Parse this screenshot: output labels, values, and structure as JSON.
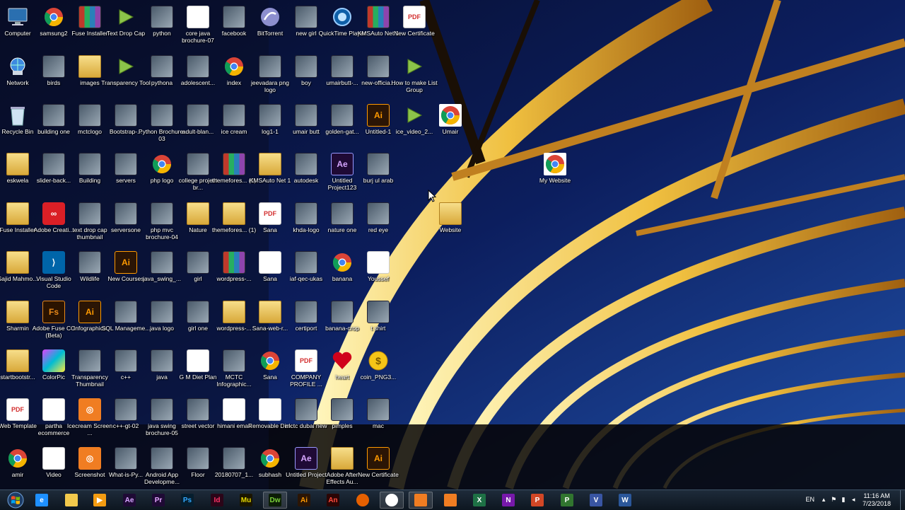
{
  "desktop": {
    "icons": [
      {
        "label": "Computer",
        "type": "computer",
        "icon": "computer-icon"
      },
      {
        "label": "samsung2",
        "type": "chrome",
        "icon": "chrome-icon"
      },
      {
        "label": "Fuse Installer",
        "type": "winrar",
        "icon": "winrar-icon"
      },
      {
        "label": "Text Drop Cap",
        "type": "video",
        "icon": "video-file-icon"
      },
      {
        "label": "python",
        "type": "image",
        "icon": "image-thumbnail-icon"
      },
      {
        "label": "core java brochure-07",
        "type": "doc",
        "icon": "document-icon"
      },
      {
        "label": "facebook",
        "type": "image",
        "icon": "image-thumbnail-icon"
      },
      {
        "label": "BitTorrent",
        "type": "bittorrent",
        "icon": "bittorrent-icon"
      },
      {
        "label": "new girl",
        "type": "image",
        "icon": "image-thumbnail-icon"
      },
      {
        "label": "QuickTime Player",
        "type": "quicktime",
        "icon": "quicktime-icon"
      },
      {
        "label": "KMSAuto Net 1",
        "type": "winrar",
        "icon": "winrar-icon"
      },
      {
        "label": "New Certificate",
        "type": "pdf",
        "icon": "pdf-icon"
      },
      {
        "label": "Network",
        "type": "network",
        "icon": "network-icon"
      },
      {
        "label": "birds",
        "type": "image",
        "icon": "image-thumbnail-icon"
      },
      {
        "label": "images",
        "type": "folder",
        "icon": "folder-icon"
      },
      {
        "label": "Transparency Tool",
        "type": "video",
        "icon": "video-file-icon"
      },
      {
        "label": "pythona",
        "type": "image",
        "icon": "image-thumbnail-icon"
      },
      {
        "label": "adolescent...",
        "type": "image",
        "icon": "image-thumbnail-icon"
      },
      {
        "label": "index",
        "type": "chrome",
        "icon": "chrome-icon"
      },
      {
        "label": "jeevadara png logo",
        "type": "image",
        "icon": "image-thumbnail-icon"
      },
      {
        "label": "boy",
        "type": "image",
        "icon": "image-thumbnail-icon"
      },
      {
        "label": "umairbutt-...",
        "type": "image",
        "icon": "image-thumbnail-icon"
      },
      {
        "label": "new-officia...",
        "type": "image",
        "icon": "image-thumbnail-icon"
      },
      {
        "label": "How to make List Group",
        "type": "video",
        "icon": "video-file-icon"
      },
      {
        "label": "Recycle Bin",
        "type": "recycle",
        "icon": "recycle-bin-icon"
      },
      {
        "label": "building one",
        "type": "image",
        "icon": "image-thumbnail-icon"
      },
      {
        "label": "mctclogo",
        "type": "image",
        "icon": "image-thumbnail-icon"
      },
      {
        "label": "Bootstrap-...",
        "type": "image",
        "icon": "image-thumbnail-icon"
      },
      {
        "label": "Python Brochure-03",
        "type": "image",
        "icon": "image-thumbnail-icon"
      },
      {
        "label": "adult-blan...",
        "type": "image",
        "icon": "image-thumbnail-icon"
      },
      {
        "label": "ice cream",
        "type": "image",
        "icon": "image-thumbnail-icon"
      },
      {
        "label": "log1-1",
        "type": "image",
        "icon": "image-thumbnail-icon"
      },
      {
        "label": "umair butt",
        "type": "image",
        "icon": "image-thumbnail-icon"
      },
      {
        "label": "golden-gat...",
        "type": "image",
        "icon": "image-thumbnail-icon"
      },
      {
        "label": "Untitled-1",
        "type": "ai",
        "icon": "illustrator-icon"
      },
      {
        "label": "ice_video_2...",
        "type": "video",
        "icon": "video-file-icon"
      },
      {
        "label": "Umair",
        "type": "chromefile",
        "icon": "chrome-file-icon"
      },
      {
        "label": "eskwela",
        "type": "folder",
        "icon": "folder-icon"
      },
      {
        "label": "slider-back...",
        "type": "image",
        "icon": "image-thumbnail-icon"
      },
      {
        "label": "Building",
        "type": "image",
        "icon": "image-thumbnail-icon"
      },
      {
        "label": "servers",
        "type": "image",
        "icon": "image-thumbnail-icon"
      },
      {
        "label": "php logo",
        "type": "chrome",
        "icon": "chrome-icon"
      },
      {
        "label": "college project br...",
        "type": "image",
        "icon": "image-thumbnail-icon"
      },
      {
        "label": "themefores... (1)",
        "type": "winrar",
        "icon": "winrar-icon"
      },
      {
        "label": "KMSAuto Net 1",
        "type": "folder",
        "icon": "folder-icon"
      },
      {
        "label": "autodesk",
        "type": "image",
        "icon": "image-thumbnail-icon"
      },
      {
        "label": "Untitled Project123",
        "type": "ae",
        "icon": "after-effects-icon"
      },
      {
        "label": "burj ul arab",
        "type": "image",
        "icon": "image-thumbnail-icon"
      },
      {
        "label": "My Website",
        "type": "chromefile",
        "icon": "chrome-file-icon"
      },
      {
        "label": "Fuse Installer",
        "type": "pdffolder",
        "icon": "folder-icon"
      },
      {
        "label": "Adobe Creati...",
        "type": "acc",
        "icon": "creative-cloud-icon"
      },
      {
        "label": "text drop cap thumbnail",
        "type": "image",
        "icon": "image-thumbnail-icon"
      },
      {
        "label": "serversone",
        "type": "image",
        "icon": "image-thumbnail-icon"
      },
      {
        "label": "php mvc brochure-04",
        "type": "image",
        "icon": "image-thumbnail-icon"
      },
      {
        "label": "Nature",
        "type": "folder",
        "icon": "folder-icon"
      },
      {
        "label": "themefores... (1)",
        "type": "folder",
        "icon": "folder-icon"
      },
      {
        "label": "Sana",
        "type": "pdf",
        "icon": "pdf-icon"
      },
      {
        "label": "khda-logo",
        "type": "image",
        "icon": "image-thumbnail-icon"
      },
      {
        "label": "nature one",
        "type": "image",
        "icon": "image-thumbnail-icon"
      },
      {
        "label": "red eye",
        "type": "image",
        "icon": "image-thumbnail-icon"
      },
      {
        "label": "Website",
        "type": "folder",
        "icon": "folder-icon"
      },
      {
        "label": "Sajid Mahmo...",
        "type": "folder",
        "icon": "folder-icon"
      },
      {
        "label": "Visual Studio Code",
        "type": "vscode",
        "icon": "vscode-icon"
      },
      {
        "label": "Wildlife",
        "type": "image",
        "icon": "image-thumbnail-icon"
      },
      {
        "label": "New Courses",
        "type": "ai",
        "icon": "illustrator-icon"
      },
      {
        "label": "java_swing_...",
        "type": "image",
        "icon": "image-thumbnail-icon"
      },
      {
        "label": "girl",
        "type": "image",
        "icon": "image-thumbnail-icon"
      },
      {
        "label": "wordpress-...",
        "type": "winrar",
        "icon": "winrar-icon"
      },
      {
        "label": "Sana",
        "type": "doc",
        "icon": "document-icon"
      },
      {
        "label": "iaf-qec-ukas",
        "type": "image",
        "icon": "image-thumbnail-icon"
      },
      {
        "label": "banana",
        "type": "chrome",
        "icon": "chrome-icon"
      },
      {
        "label": "Youssef",
        "type": "doc",
        "icon": "document-icon"
      },
      {
        "label": "Sharmin",
        "type": "folder",
        "icon": "folder-icon"
      },
      {
        "label": "Adobe Fuse CC (Beta)",
        "type": "fs",
        "icon": "adobe-fuse-icon"
      },
      {
        "label": "Infographics",
        "type": "ai",
        "icon": "illustrator-icon"
      },
      {
        "label": "SQL Manageme...",
        "type": "image",
        "icon": "image-thumbnail-icon"
      },
      {
        "label": "java logo",
        "type": "image",
        "icon": "image-thumbnail-icon"
      },
      {
        "label": "girl one",
        "type": "image",
        "icon": "image-thumbnail-icon"
      },
      {
        "label": "wordpress-...",
        "type": "folder",
        "icon": "folder-icon"
      },
      {
        "label": "Sana-web-r...",
        "type": "folder",
        "icon": "folder-icon"
      },
      {
        "label": "certiport",
        "type": "image",
        "icon": "image-thumbnail-icon"
      },
      {
        "label": "banana-crop",
        "type": "image",
        "icon": "image-thumbnail-icon"
      },
      {
        "label": "t shirt",
        "type": "image",
        "icon": "image-thumbnail-icon"
      },
      {
        "label": "startbootstr...",
        "type": "folder",
        "icon": "folder-icon"
      },
      {
        "label": "ColorPic",
        "type": "colorpic",
        "icon": "colorpic-icon"
      },
      {
        "label": "Transparency Thumbnail",
        "type": "image",
        "icon": "image-thumbnail-icon"
      },
      {
        "label": "c++",
        "type": "image",
        "icon": "image-thumbnail-icon"
      },
      {
        "label": "java",
        "type": "image",
        "icon": "image-thumbnail-icon"
      },
      {
        "label": "G M Diet Plan",
        "type": "doc",
        "icon": "document-icon"
      },
      {
        "label": "MCTC Infographic...",
        "type": "image",
        "icon": "image-thumbnail-icon"
      },
      {
        "label": "Sana",
        "type": "chrome",
        "icon": "chrome-icon"
      },
      {
        "label": "COMPANY PROFILE ...",
        "type": "pdf",
        "icon": "pdf-icon"
      },
      {
        "label": "heart",
        "type": "heart",
        "icon": "heart-icon"
      },
      {
        "label": "coin_PNG3...",
        "type": "coin",
        "icon": "coin-icon"
      },
      {
        "label": "Web Template",
        "type": "pdf",
        "icon": "pdf-icon"
      },
      {
        "label": "partha ecommerce",
        "type": "doc",
        "icon": "document-icon"
      },
      {
        "label": "Icecream Screen ...",
        "type": "icecream",
        "icon": "icecream-recorder-icon"
      },
      {
        "label": "c++-gt-02",
        "type": "image",
        "icon": "image-thumbnail-icon"
      },
      {
        "label": "java swing brochure-05",
        "type": "image",
        "icon": "image-thumbnail-icon"
      },
      {
        "label": "street vector",
        "type": "image",
        "icon": "image-thumbnail-icon"
      },
      {
        "label": "himani email",
        "type": "doc",
        "icon": "document-icon"
      },
      {
        "label": "Removable Disk",
        "type": "doc",
        "icon": "removable-disk-icon"
      },
      {
        "label": "mctc dubai new",
        "type": "image",
        "icon": "image-thumbnail-icon"
      },
      {
        "label": "pimples",
        "type": "image",
        "icon": "image-thumbnail-icon"
      },
      {
        "label": "mac",
        "type": "image",
        "icon": "image-thumbnail-icon"
      },
      {
        "label": "amir",
        "type": "chrome",
        "icon": "chrome-icon"
      },
      {
        "label": "Video",
        "type": "doc",
        "icon": "document-icon"
      },
      {
        "label": "Screenshot",
        "type": "icecream",
        "icon": "icecream-screenshot-icon"
      },
      {
        "label": "What-is-Py...",
        "type": "image",
        "icon": "image-thumbnail-icon"
      },
      {
        "label": "Android App Developme...",
        "type": "image",
        "icon": "image-thumbnail-icon"
      },
      {
        "label": "Floor",
        "type": "image",
        "icon": "image-thumbnail-icon"
      },
      {
        "label": "20180707_1...",
        "type": "image",
        "icon": "image-thumbnail-icon"
      },
      {
        "label": "subhash",
        "type": "chrome",
        "icon": "chrome-icon"
      },
      {
        "label": "Untitled Project",
        "type": "ae",
        "icon": "after-effects-icon"
      },
      {
        "label": "Adobe After Effects Au...",
        "type": "aefolder",
        "icon": "folder-icon"
      },
      {
        "label": "New Certificate",
        "type": "ai",
        "icon": "illustrator-icon"
      }
    ]
  },
  "taskbar": {
    "start_icon": "windows-start-icon",
    "apps": [
      {
        "name": "ie",
        "icon": "internet-explorer-icon",
        "glyph": "e"
      },
      {
        "name": "explorer",
        "icon": "file-explorer-icon",
        "glyph": ""
      },
      {
        "name": "media",
        "icon": "media-player-icon",
        "glyph": "▶"
      },
      {
        "name": "ae",
        "icon": "after-effects-icon",
        "glyph": "Ae"
      },
      {
        "name": "pr",
        "icon": "premiere-icon",
        "glyph": "Pr"
      },
      {
        "name": "ps",
        "icon": "photoshop-icon",
        "glyph": "Ps"
      },
      {
        "name": "id",
        "icon": "indesign-icon",
        "glyph": "Id"
      },
      {
        "name": "mu",
        "icon": "muse-icon",
        "glyph": "Mu"
      },
      {
        "name": "dw",
        "icon": "dreamweaver-icon",
        "glyph": "Dw"
      },
      {
        "name": "ai",
        "icon": "illustrator-icon",
        "glyph": "Ai"
      },
      {
        "name": "an",
        "icon": "animate-icon",
        "glyph": "An"
      },
      {
        "name": "firefox",
        "icon": "firefox-icon",
        "glyph": ""
      },
      {
        "name": "chrome",
        "icon": "chrome-icon",
        "glyph": ""
      },
      {
        "name": "icecream",
        "icon": "icecream-recorder-icon",
        "glyph": ""
      },
      {
        "name": "icecream2",
        "icon": "icecream-screenshot-icon",
        "glyph": ""
      },
      {
        "name": "excel",
        "icon": "excel-icon",
        "glyph": "X"
      },
      {
        "name": "onenote",
        "icon": "onenote-icon",
        "glyph": "N"
      },
      {
        "name": "powerpoint",
        "icon": "powerpoint-icon",
        "glyph": "P"
      },
      {
        "name": "project",
        "icon": "project-icon",
        "glyph": "P"
      },
      {
        "name": "visio",
        "icon": "visio-icon",
        "glyph": "V"
      },
      {
        "name": "word",
        "icon": "word-icon",
        "glyph": "W"
      }
    ],
    "tray": {
      "language": "EN",
      "time": "11:16 AM",
      "date": "7/23/2018"
    }
  }
}
